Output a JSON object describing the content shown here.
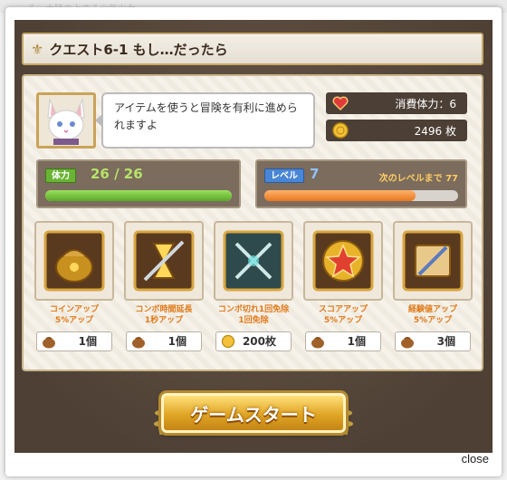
{
  "background_text": "る…大陸の上する少年少女",
  "title": "クエスト6-1 もし…だったら",
  "dialog": "アイテムを使うと冒険を有利に進められますよ",
  "stamina": {
    "label": "消費体力：6"
  },
  "coins": {
    "label": "2496 枚"
  },
  "hp": {
    "tag": "体力",
    "value": "26 / 26",
    "fill_fraction": 1.0
  },
  "level": {
    "tag": "レベル",
    "value": "7",
    "next_label": "次のレベルまで 77",
    "fill_fraction": 0.78
  },
  "items": [
    {
      "name_line1": "コインアップ",
      "name_line2": "5%アップ",
      "count": "1個",
      "icon": "coin-bag-icon",
      "cost_icon": "pouch-icon"
    },
    {
      "name_line1": "コンボ時間延長",
      "name_line2": "1秒アップ",
      "count": "1個",
      "icon": "hourglass-sword-icon",
      "cost_icon": "pouch-icon"
    },
    {
      "name_line1": "コンボ切れ1回免除",
      "name_line2": "1回免除",
      "count": "200枚",
      "icon": "crossed-swords-icon",
      "cost_icon": "coin-icon"
    },
    {
      "name_line1": "スコアアップ",
      "name_line2": "5%アップ",
      "count": "1個",
      "icon": "star-icon",
      "cost_icon": "pouch-icon"
    },
    {
      "name_line1": "経験値アップ",
      "name_line2": "5%アップ",
      "count": "3個",
      "icon": "scroll-sword-icon",
      "cost_icon": "pouch-icon"
    }
  ],
  "start_button": "ゲームスタート",
  "close_label": "close",
  "colors": {
    "accent_gold": "#c9a35a",
    "hp_green": "#69b434",
    "level_orange": "#f08a2a"
  }
}
